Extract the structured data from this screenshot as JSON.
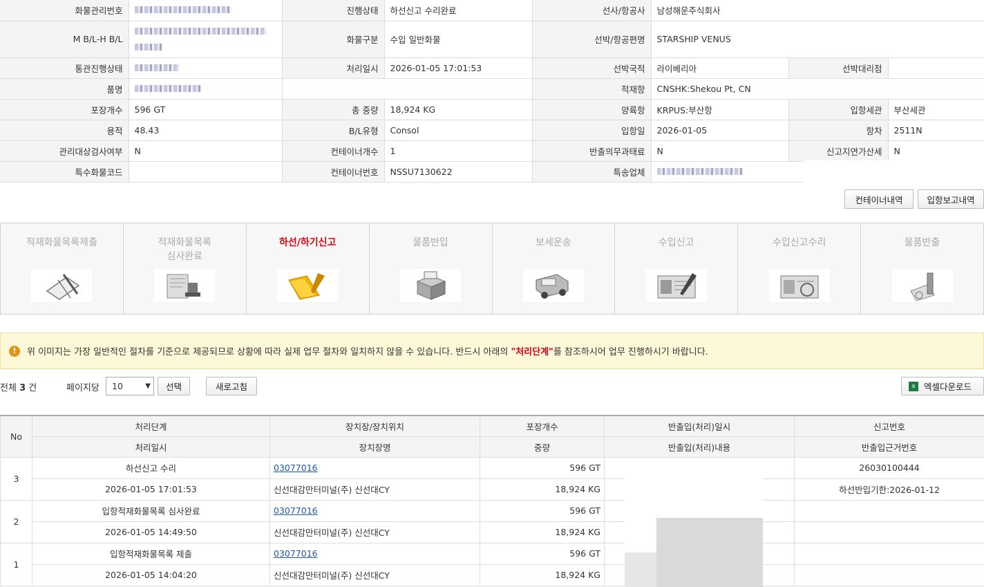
{
  "cargo": {
    "mgmt_no_label": "화물관리번호",
    "status_label": "진행상태",
    "status": "하선신고 수리완료",
    "carrier_label": "선사/항공사",
    "carrier": "남성해운주식회사",
    "bl_label": "M B/L-H B/L",
    "cargo_type_label": "화물구분",
    "cargo_type": "수입 일반화물",
    "vessel_label": "선박/항공편명",
    "vessel": "STARSHIP VENUS",
    "customs_status_label": "통관진행상태",
    "processed_at_label": "처리일시",
    "processed_at": "2026-01-05 17:01:53",
    "vessel_country_label": "선박국적",
    "vessel_country": "라이베리아",
    "ship_agent_label": "선박대리점",
    "item_label": "품명",
    "loading_port_label": "적재항",
    "loading_port": "CNSHK:Shekou Pt, CN",
    "packages_label": "포장개수",
    "packages": "596 GT",
    "total_weight_label": "총 중량",
    "total_weight": "18,924 KG",
    "unloading_port_label": "양륙항",
    "unloading_port": "KRPUS:부산항",
    "entry_customs_label": "입항세관",
    "entry_customs": "부산세관",
    "volume_label": "용적",
    "volume": "48.43",
    "bl_type_label": "B/L유형",
    "bl_type": "Consol",
    "entry_date_label": "입항일",
    "entry_date": "2026-01-05",
    "voyage_label": "항차",
    "voyage": "2511N",
    "inspection_label": "관리대상검사여부",
    "inspection": "N",
    "container_count_label": "컨테이너개수",
    "container_count": "1",
    "release_duty_label": "반출의무과태료",
    "release_duty": "N",
    "late_tax_label": "신고지연가산세",
    "late_tax": "N",
    "special_cargo_label": "특수화물코드",
    "container_no_label": "컨테이너번호",
    "container_no": "NSSU7130622",
    "forwarder_label": "특송업체"
  },
  "buttons": {
    "container_history": "컨테이너내역",
    "entry_report_history": "입항보고내역"
  },
  "steps": [
    {
      "label": "적재화물목록제출",
      "icon": "clipboard-pen-icon",
      "active": false
    },
    {
      "label": "적재화물목록\n심사완료",
      "icon": "stamp-icon",
      "active": false
    },
    {
      "label": "하선/하기신고",
      "icon": "folder-pen-icon",
      "active": true
    },
    {
      "label": "물품반입",
      "icon": "box-icon",
      "active": false
    },
    {
      "label": "보세운송",
      "icon": "truck-icon",
      "active": false
    },
    {
      "label": "수입신고",
      "icon": "document-pen-icon",
      "active": false
    },
    {
      "label": "수입신고수리",
      "icon": "approved-document-icon",
      "active": false
    },
    {
      "label": "물품반출",
      "icon": "release-icon",
      "active": false
    }
  ],
  "notice": {
    "before": "위 이미지는 가장 일반적인 절차를 기준으로 제공되므로 상황에 따라 실제 업무 절차와 일치하지 않을 수 있습니다. 반드시 아래의 ",
    "highlight": "\"처리단계\"",
    "after": "를 참조하시어 업무 진행하시기 바랍니다."
  },
  "list": {
    "total_prefix": "전체 ",
    "total_count": "3",
    "total_suffix": " 건",
    "per_page_label": "페이지당",
    "per_page_value": "10",
    "select_button": "선택",
    "refresh_button": "새로고침",
    "excel_button": "엑셀다운로드"
  },
  "grid": {
    "headers_top": [
      "No",
      "처리단계",
      "장치장/장치위치",
      "포장개수",
      "반출입(처리)일시",
      "신고번호"
    ],
    "headers_bottom": [
      "처리일시",
      "장치장명",
      "중량",
      "반출입(처리)내용",
      "반출입근거번호"
    ],
    "rows": [
      {
        "no": "3",
        "stage": "하선신고 수리",
        "location_code": "03077016",
        "packages": "596 GT",
        "report_no": "26030100444",
        "processed_at": "2026-01-05 17:01:53",
        "warehouse": "신선대감만터미널(주) 신선대CY",
        "weight": "18,924 KG",
        "basis_no": "하선반입기한:2026-01-12"
      },
      {
        "no": "2",
        "stage": "입항적재화물목록 심사완료",
        "location_code": "03077016",
        "packages": "596 GT",
        "report_no": "",
        "processed_at": "2026-01-05 14:49:50",
        "warehouse": "신선대감만터미널(주) 신선대CY",
        "weight": "18,924 KG",
        "basis_no": ""
      },
      {
        "no": "1",
        "stage": "입항적재화물목록 제출",
        "location_code": "03077016",
        "packages": "596 GT",
        "report_no": "",
        "processed_at": "2026-01-05 14:04:20",
        "warehouse": "신선대감만터미널(주) 신선대CY",
        "weight": "18,924 KG",
        "basis_no": ""
      }
    ]
  }
}
